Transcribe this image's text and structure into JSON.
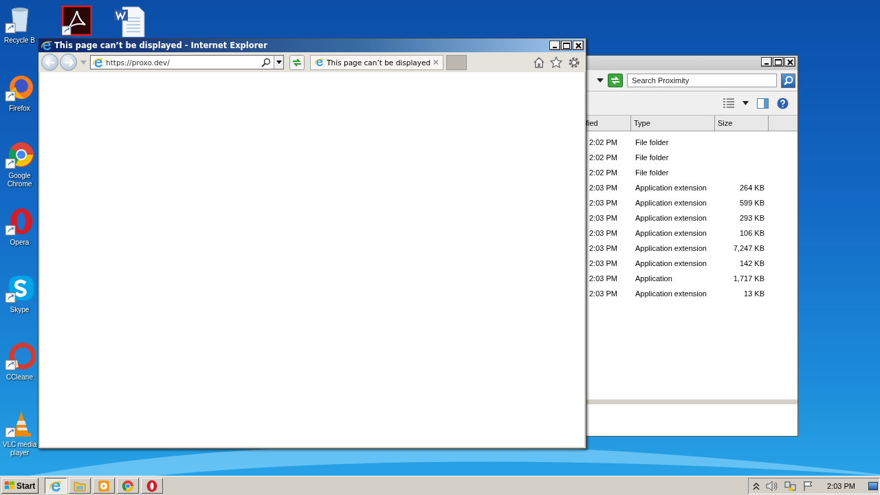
{
  "desktop": {
    "icons": [
      {
        "label": "Recycle B"
      },
      {
        "label": "Firefox"
      },
      {
        "label": "Google Chrome"
      },
      {
        "label": "Opera"
      },
      {
        "label": "Skype"
      },
      {
        "label": "CCleane"
      },
      {
        "label": "VLC media player"
      }
    ]
  },
  "explorer_window": {
    "search": {
      "placeholder": "Search Proximity"
    },
    "columns": [
      "fied",
      "Type",
      "Size"
    ],
    "rows": [
      {
        "modified": "2:02 PM",
        "type": "File folder",
        "size": ""
      },
      {
        "modified": "2:02 PM",
        "type": "File folder",
        "size": ""
      },
      {
        "modified": "2:02 PM",
        "type": "File folder",
        "size": ""
      },
      {
        "modified": "2:03 PM",
        "type": "Application extension",
        "size": "264 KB"
      },
      {
        "modified": "2:03 PM",
        "type": "Application extension",
        "size": "599 KB"
      },
      {
        "modified": "2:03 PM",
        "type": "Application extension",
        "size": "293 KB"
      },
      {
        "modified": "2:03 PM",
        "type": "Application extension",
        "size": "106 KB"
      },
      {
        "modified": "2:03 PM",
        "type": "Application extension",
        "size": "7,247 KB"
      },
      {
        "modified": "2:03 PM",
        "type": "Application extension",
        "size": "142 KB"
      },
      {
        "modified": "2:03 PM",
        "type": "Application",
        "size": "1,717 KB"
      },
      {
        "modified": "2:03 PM",
        "type": "Application extension",
        "size": "13 KB"
      }
    ]
  },
  "browser_window": {
    "title": "This page can’t be displayed - Internet Explorer",
    "address": "https://proxo.dev/",
    "tabs": [
      {
        "label": "This page can’t be displayed",
        "selected": true
      }
    ]
  },
  "taskbar": {
    "start_label": "Start",
    "items": [
      {
        "selected": true
      },
      {
        "selected": false
      },
      {
        "selected": false
      },
      {
        "selected": false
      },
      {
        "selected": false
      }
    ],
    "clock": "2:03 PM"
  }
}
